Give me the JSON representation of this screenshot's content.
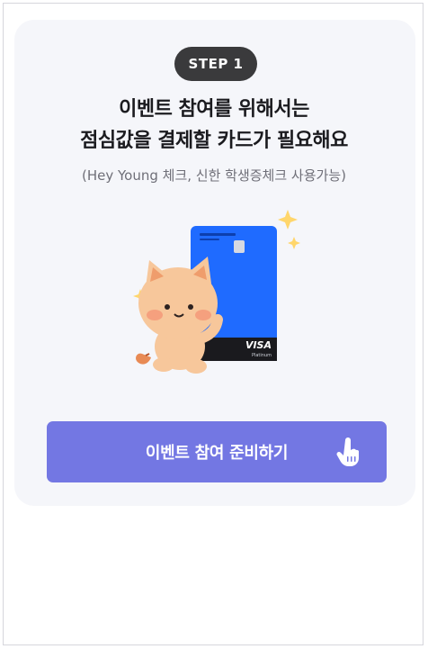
{
  "step_badge": "STEP 1",
  "title_line1": "이벤트 참여를 위해서는",
  "title_line2": "점심값을 결제할 카드가 필요해요",
  "subtitle": "(Hey Young 체크, 신한 학생증체크 사용가능)",
  "illustration": {
    "card_brand": "VISA",
    "card_tier": "Platinum",
    "card_color": "#1f6bff",
    "character": "cat-mascot"
  },
  "cta_button": {
    "label": "이벤트 참여 준비하기",
    "icon": "tap-hand-icon",
    "color": "#7377e3"
  },
  "colors": {
    "card_bg": "#f5f6fa",
    "badge_bg": "#3a3a3c",
    "title_text": "#1b1b1f",
    "subtitle_text": "#6f6f78"
  }
}
